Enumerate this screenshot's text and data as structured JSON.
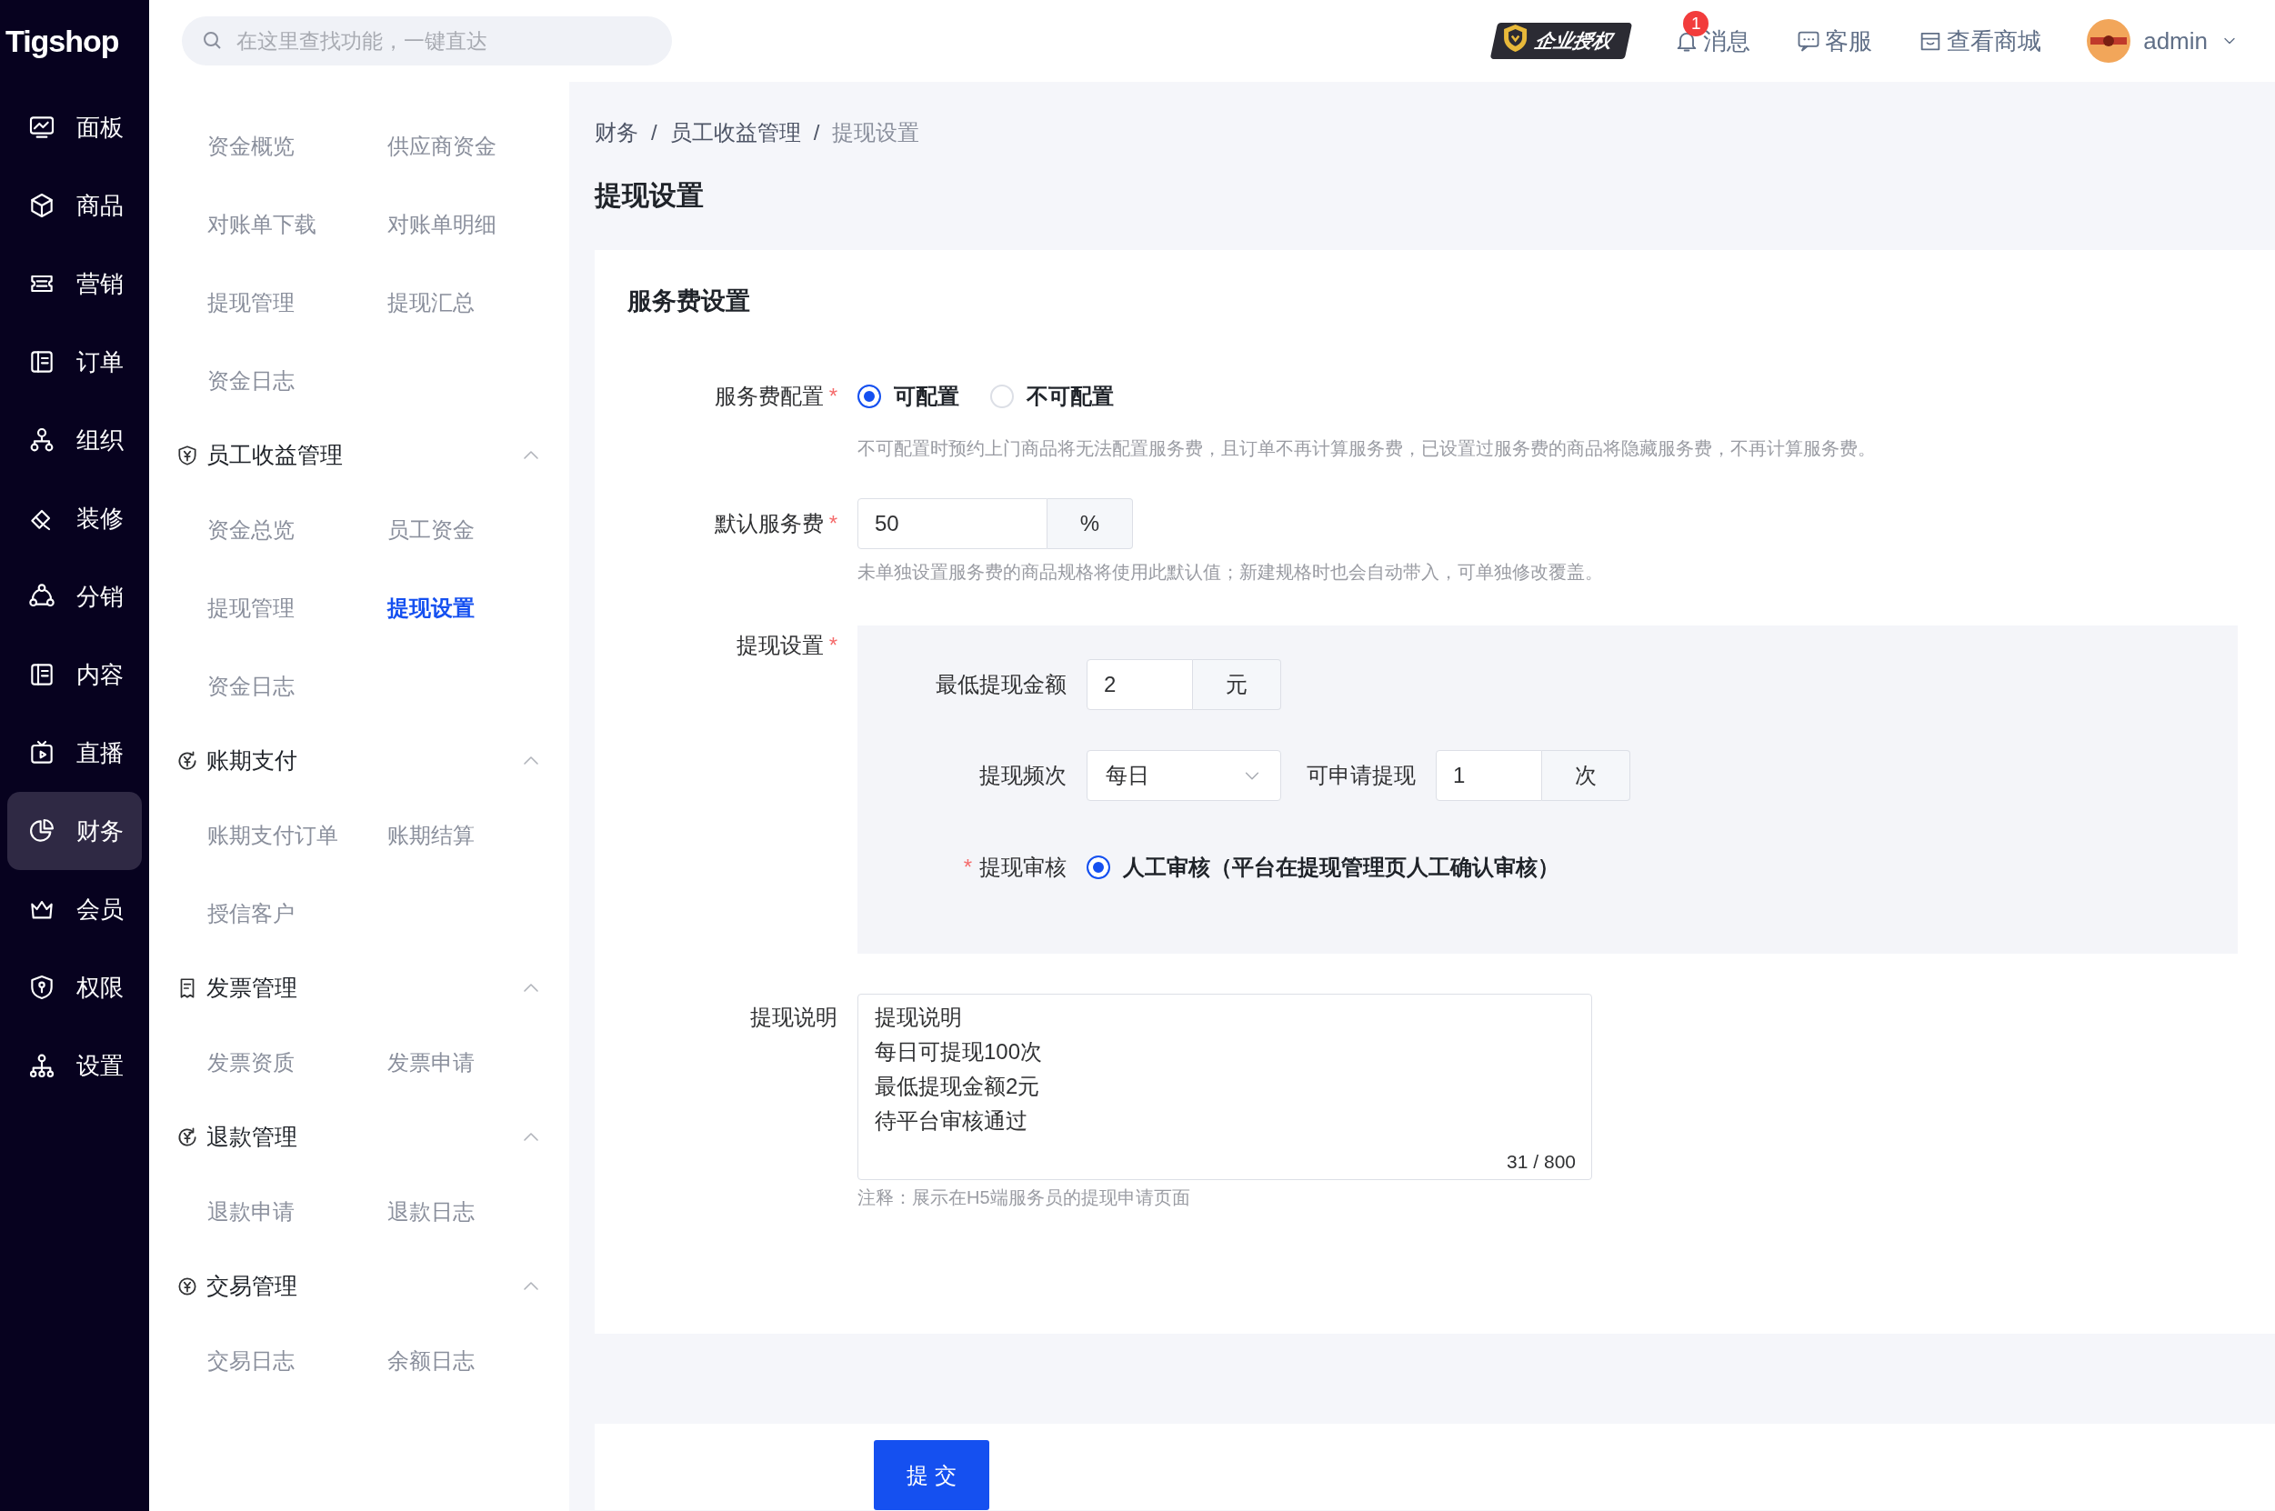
{
  "logo": {
    "text": "Tigshop"
  },
  "search": {
    "placeholder": "在这里查找功能，一键直达"
  },
  "header_actions": [
    {
      "kind": "license",
      "label": "企业授权"
    },
    {
      "kind": "messages",
      "label": "消息",
      "badge": "1"
    },
    {
      "kind": "service",
      "label": "客服"
    },
    {
      "kind": "store",
      "label": "查看商城"
    }
  ],
  "user": {
    "name": "admin"
  },
  "sidebar": {
    "items": [
      {
        "label": "面板",
        "selected": false
      },
      {
        "label": "商品",
        "selected": false
      },
      {
        "label": "营销",
        "selected": false
      },
      {
        "label": "订单",
        "selected": false
      },
      {
        "label": "组织",
        "selected": false
      },
      {
        "label": "装修",
        "selected": false
      },
      {
        "label": "分销",
        "selected": false
      },
      {
        "label": "内容",
        "selected": false
      },
      {
        "label": "直播",
        "selected": false
      },
      {
        "label": "财务",
        "selected": true
      },
      {
        "label": "会员",
        "selected": false
      },
      {
        "label": "权限",
        "selected": false
      },
      {
        "label": "设置",
        "selected": false
      }
    ]
  },
  "submenu": {
    "groups": [
      {
        "items": [
          {
            "label": "资金概览",
            "selected": false
          },
          {
            "label": "供应商资金",
            "selected": false
          },
          {
            "label": "对账单下载",
            "selected": false
          },
          {
            "label": "对账单明细",
            "selected": false
          },
          {
            "label": "提现管理",
            "selected": false
          },
          {
            "label": "提现汇总",
            "selected": false
          },
          {
            "label": "资金日志",
            "selected": false
          }
        ]
      },
      {
        "title": "员工收益管理",
        "expanded": true,
        "items": [
          {
            "label": "资金总览",
            "selected": false
          },
          {
            "label": "员工资金",
            "selected": false
          },
          {
            "label": "提现管理",
            "selected": false
          },
          {
            "label": "提现设置",
            "selected": true
          },
          {
            "label": "资金日志",
            "selected": false
          }
        ]
      },
      {
        "title": "账期支付",
        "expanded": true,
        "items": [
          {
            "label": "账期支付订单",
            "selected": false
          },
          {
            "label": "账期结算",
            "selected": false
          },
          {
            "label": "授信客户",
            "selected": false
          }
        ]
      },
      {
        "title": "发票管理",
        "expanded": true,
        "items": [
          {
            "label": "发票资质",
            "selected": false
          },
          {
            "label": "发票申请",
            "selected": false
          }
        ]
      },
      {
        "title": "退款管理",
        "expanded": true,
        "items": [
          {
            "label": "退款申请",
            "selected": false
          },
          {
            "label": "退款日志",
            "selected": false
          }
        ]
      },
      {
        "title": "交易管理",
        "expanded": true,
        "items": [
          {
            "label": "交易日志",
            "selected": false
          },
          {
            "label": "余额日志",
            "selected": false
          }
        ]
      }
    ]
  },
  "breadcrumb": {
    "separator": "/",
    "items": [
      "财务",
      "员工收益管理",
      "提现设置"
    ]
  },
  "page_title": "提现设置",
  "form": {
    "section_title": "服务费设置",
    "service_fee_config": {
      "label": "服务费配置",
      "required_mark": "*",
      "options": [
        {
          "label": "可配置",
          "selected": true
        },
        {
          "label": "不可配置",
          "selected": false
        }
      ],
      "help": "不可配置时预约上门商品将无法配置服务费，且订单不再计算服务费，已设置过服务费的商品将隐藏服务费，不再计算服务费。"
    },
    "default_fee": {
      "label": "默认服务费",
      "required_mark": "*",
      "value": "50",
      "suffix": "%",
      "help": "未单独设置服务费的商品规格将使用此默认值；新建规格时也会自动带入，可单独修改覆盖。"
    },
    "withdraw": {
      "label": "提现设置",
      "required_mark": "*",
      "min_amount": {
        "label": "最低提现金额",
        "value": "2",
        "suffix": "元"
      },
      "frequency": {
        "label": "提现频次",
        "value": "每日"
      },
      "count": {
        "label": "可申请提现",
        "value": "1",
        "suffix": "次"
      },
      "review": {
        "label": "提现审核",
        "required_mark": "*",
        "options": [
          {
            "label": "人工审核（平台在提现管理页人工确认审核）",
            "selected": true
          }
        ]
      }
    },
    "description": {
      "label": "提现说明",
      "lines": [
        "提现说明",
        "每日可提现100次",
        "最低提现金额2元",
        "待平台审核通过"
      ],
      "counter": "31 / 800",
      "note": "注释：展示在H5端服务员的提现申请页面"
    }
  },
  "submit": "提 交"
}
